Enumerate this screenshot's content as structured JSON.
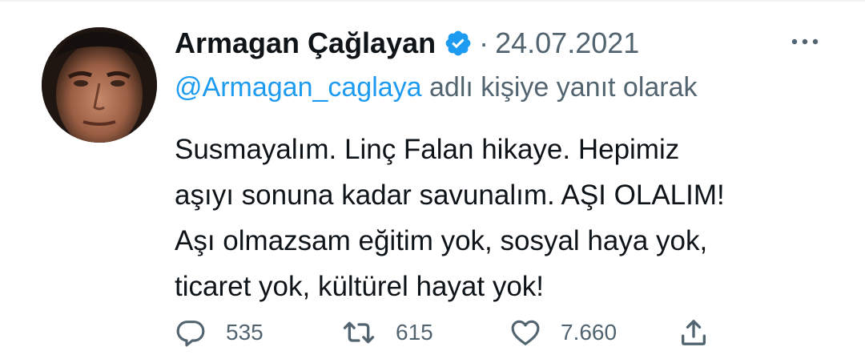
{
  "tweet": {
    "author_name": "Armagan Çağlayan",
    "separator": "·",
    "date": "24.07.2021",
    "reply_handle": "@Armagan_caglaya",
    "reply_suffix": " adlı kişiye yanıt olarak",
    "body_lines": [
      "Susmayalım. Linç Falan hikaye. Hepimiz",
      "aşıyı sonuna kadar savunalım. AŞI OLALIM!",
      "Aşı olmazsam eğitim yok, sosyal haya yok,",
      "ticaret yok, kültürel hayat yok!"
    ]
  },
  "actions": {
    "reply_count": "535",
    "retweet_count": "615",
    "like_count": "7.660"
  },
  "icons": {
    "verified": "verified-badge-icon",
    "more": "more-icon",
    "reply": "reply-icon",
    "retweet": "retweet-icon",
    "like": "like-icon",
    "share": "share-icon"
  },
  "colors": {
    "accent": "#1d9bf0",
    "text": "#0f1419",
    "secondary": "#536471"
  }
}
